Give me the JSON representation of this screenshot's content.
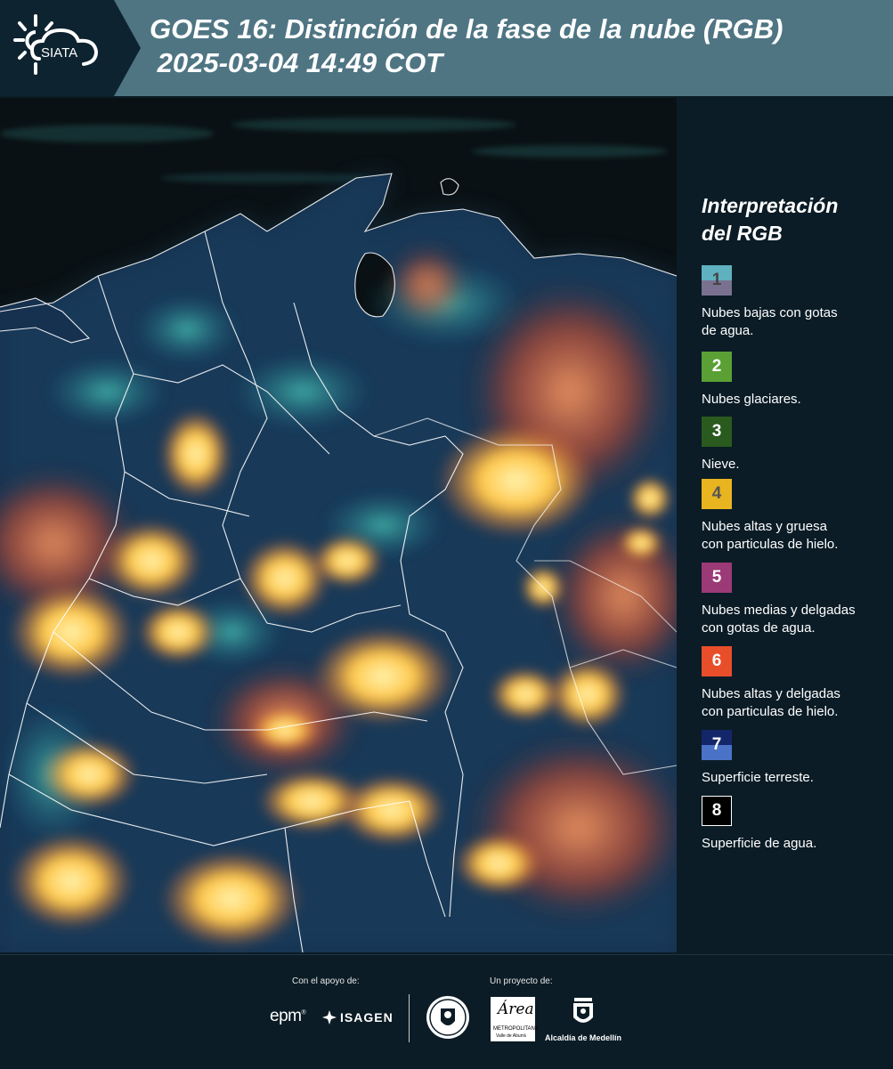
{
  "header": {
    "logo_text": "SIATA",
    "title_line1": "GOES 16: Distinción de la fase de la nube (RGB)",
    "title_line2": " 2025-03-04 14:49 COT"
  },
  "map": {
    "description_icon": "satellite-rgb-image",
    "colors": {
      "ocean": "#0a1114",
      "land": "#16314f",
      "cloud_ice_thick": "#ffc548",
      "cloud_ice_thin": "#e5613a",
      "cloud_low_water": "#3fb6a8",
      "border": "#ffffff"
    }
  },
  "legend": {
    "title_line1": "Interpretación",
    "title_line2": "del RGB",
    "items": [
      {
        "number": "1",
        "label_line1": "Nubes bajas con gotas",
        "label_line2": "de agua.",
        "color_top": "#5fb1bf",
        "color_bottom": "#7a7190",
        "number_color": "#444444"
      },
      {
        "number": "2",
        "label_line1": "Nubes glaciares.",
        "label_line2": "",
        "color_top": "#5aa035",
        "color_bottom": "#5aa035",
        "number_color": "#ffffff"
      },
      {
        "number": "3",
        "label_line1": "Nieve.",
        "label_line2": "",
        "color_top": "#2a5a1e",
        "color_bottom": "#2a5a1e",
        "number_color": "#ffffff"
      },
      {
        "number": "4",
        "label_line1": "Nubes altas y gruesa",
        "label_line2": "con particulas de hielo.",
        "color_top": "#e8b420",
        "color_bottom": "#e8b420",
        "number_color": "#555555"
      },
      {
        "number": "5",
        "label_line1": "Nubes medias y delgadas",
        "label_line2": "con gotas de agua.",
        "color_top": "#9b3a76",
        "color_bottom": "#9b3a76",
        "number_color": "#ffffff"
      },
      {
        "number": "6",
        "label_line1": "Nubes altas y delgadas",
        "label_line2": "con particulas de hielo.",
        "color_top": "#e84e2a",
        "color_bottom": "#e84e2a",
        "number_color": "#ffffff"
      },
      {
        "number": "7",
        "label_line1": "Superficie terreste.",
        "label_line2": "",
        "color_top": "#13266a",
        "color_bottom": "#4a72c7",
        "number_color": "#ffffff"
      },
      {
        "number": "8",
        "label_line1": "Superficie de agua.",
        "label_line2": "",
        "color_top": "#000000",
        "color_bottom": "#000000",
        "number_color": "#ffffff"
      }
    ]
  },
  "footer": {
    "support_label": "Con el apoyo de:",
    "project_label": "Un proyecto de:",
    "epm_text": "epm",
    "isagen_text": "ISAGEN",
    "area_script": "Área",
    "area_sub1": "METROPOLITANA",
    "area_sub2": "Valle de Aburrá",
    "alcaldia_text": "Alcaldía de Medellín"
  }
}
